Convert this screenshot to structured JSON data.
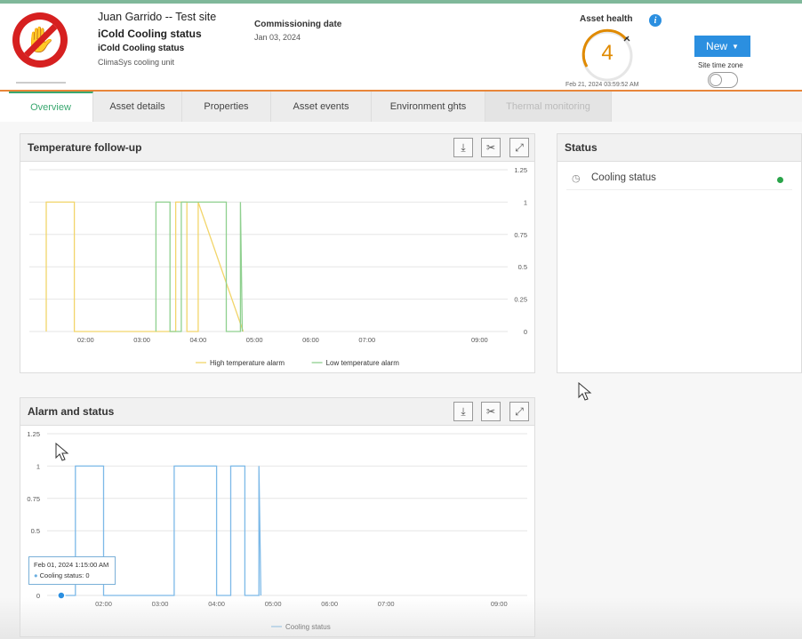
{
  "header": {
    "site_title": "Juan Garrido -- Test site",
    "asset_title": "iCold Cooling status",
    "asset_subtitle": "iCold Cooling status",
    "asset_description": "ClimaSys cooling unit",
    "commissioning_label": "Commissioning date",
    "commissioning_value": "Jan 03, 2024",
    "health_label": "Asset health",
    "health_value": "4",
    "health_date": "Feb 21, 2024 03:59:52 AM",
    "new_button": "New",
    "timezone_label": "Site time zone",
    "logo_icon": "stop-hand-icon",
    "colors": {
      "accent": "#2b8fe0",
      "health": "#e08a00",
      "active_tab": "#3aa870",
      "header_line": "#e8863a"
    }
  },
  "tabs": [
    {
      "label": "Overview",
      "active": true
    },
    {
      "label": "Asset details"
    },
    {
      "label": "Properties"
    },
    {
      "label": "Asset events"
    },
    {
      "label": "Environment ghts"
    },
    {
      "label": "Thermal monitoring",
      "disabled": true
    }
  ],
  "panels": {
    "temperature": {
      "title": "Temperature follow-up"
    },
    "alarm": {
      "title": "Alarm and status"
    },
    "status": {
      "title": "Status",
      "rows": [
        {
          "label": "Cooling status",
          "state_color": "#2aa44a"
        }
      ]
    }
  },
  "tooltip": {
    "date": "Feb 01, 2024 1:15:00 AM",
    "value": "Cooling status: 0"
  },
  "chart_data": [
    {
      "type": "line",
      "title": "Temperature follow-up",
      "x_ticks": [
        "02:00",
        "03:00",
        "04:00",
        "05:00",
        "06:00",
        "07:00",
        "09:00"
      ],
      "y_ticks": [
        "1.25",
        "1",
        "0.75",
        "0.5",
        "0.25",
        "0"
      ],
      "ylim": [
        0,
        1.25
      ],
      "y_axis_side": "right",
      "grid": true,
      "legend": "bottom",
      "series": [
        {
          "name": "High temperature alarm",
          "color": "#f2d56a",
          "x": [
            "01:18",
            "01:18",
            "01:48",
            "01:48",
            "03:36",
            "03:36",
            "03:48",
            "03:48",
            "04:00",
            "04:00",
            "04:48"
          ],
          "y": [
            0,
            1,
            1,
            0,
            0,
            1,
            1,
            0,
            0,
            1,
            0
          ]
        },
        {
          "name": "Low temperature alarm",
          "color": "#8fd08f",
          "x": [
            "03:15",
            "03:15",
            "03:30",
            "03:30",
            "03:42",
            "03:42",
            "04:30",
            "04:30",
            "04:45",
            "04:45",
            "04:47"
          ],
          "y": [
            0,
            1,
            1,
            0,
            0,
            1,
            1,
            0,
            0,
            1,
            0
          ]
        }
      ]
    },
    {
      "type": "line",
      "title": "Alarm and status",
      "x_ticks": [
        "02:00",
        "03:00",
        "04:00",
        "05:00",
        "06:00",
        "07:00",
        "09:00"
      ],
      "y_ticks": [
        "1.25",
        "1",
        "0.75",
        "0.5",
        "0"
      ],
      "ylim": [
        0,
        1.25
      ],
      "y_axis_side": "left",
      "grid": true,
      "legend": "bottom",
      "series": [
        {
          "name": "Cooling status",
          "color": "#7cb9e8",
          "x": [
            "01:15",
            "01:30",
            "01:30",
            "02:00",
            "02:00",
            "03:15",
            "03:15",
            "04:00",
            "04:00",
            "04:15",
            "04:15",
            "04:30",
            "04:30",
            "04:45",
            "04:45",
            "04:47"
          ],
          "y": [
            0,
            0,
            1,
            1,
            0,
            0,
            1,
            1,
            0,
            0,
            1,
            1,
            0,
            0,
            1,
            0
          ]
        }
      ]
    }
  ]
}
